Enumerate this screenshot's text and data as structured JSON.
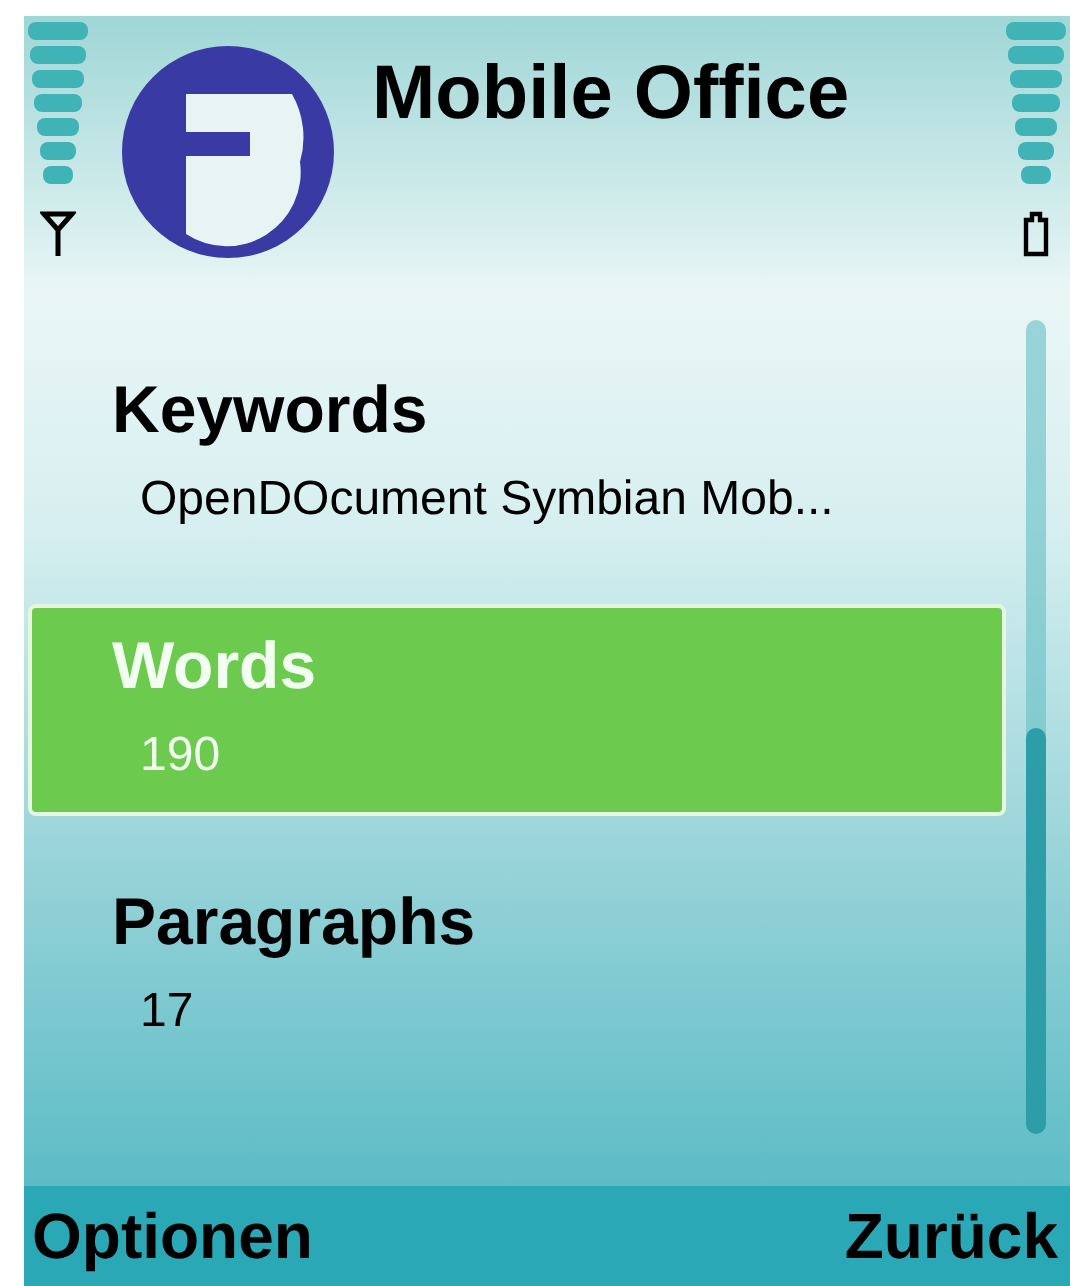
{
  "window": {
    "title": "Mobile Office"
  },
  "items": [
    {
      "label": "Keywords",
      "value": "OpenDOcument Symbian Mob...",
      "selected": false
    },
    {
      "label": "Words",
      "value": "190",
      "selected": true
    },
    {
      "label": "Paragraphs",
      "value": "17",
      "selected": false
    }
  ],
  "softkeys": {
    "left": "Optionen",
    "right": "Zurück"
  }
}
